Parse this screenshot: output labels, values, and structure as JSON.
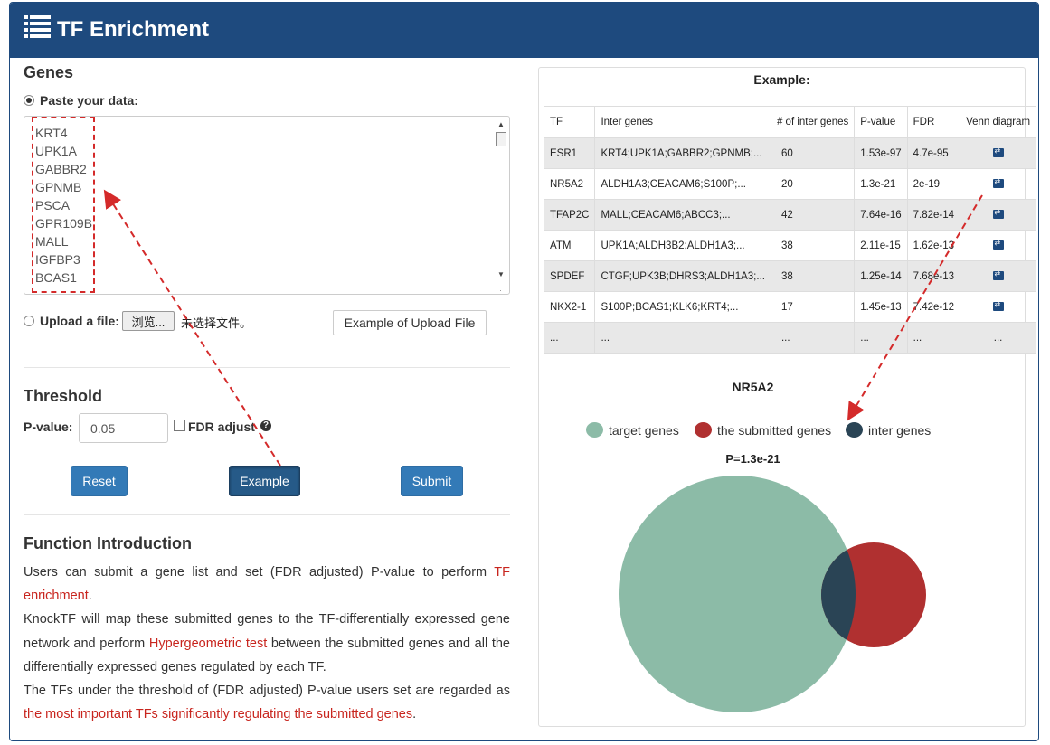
{
  "header": {
    "title": "TF Enrichment",
    "icon": "list-icon",
    "bg_color": "#1e4a7e"
  },
  "genes": {
    "section_title": "Genes",
    "paste_label": "Paste your data:",
    "gene_list": [
      "KRT4",
      "UPK1A",
      "GABBR2",
      "GPNMB",
      "PSCA",
      "GPR109B",
      "MALL",
      "IGFBP3",
      "BCAS1"
    ],
    "upload_label": "Upload a file:",
    "browse_button": "浏览...",
    "no_file_text": "未选择文件。",
    "example_upload_button": "Example of Upload File"
  },
  "threshold": {
    "section_title": "Threshold",
    "pvalue_label": "P-value:",
    "pvalue_value": "0.05",
    "fdr_label": "FDR adjust",
    "fdr_checked": false,
    "help_icon": "question-circle-icon",
    "reset_button": "Reset",
    "example_button": "Example",
    "submit_button": "Submit"
  },
  "intro": {
    "section_title": "Function Introduction",
    "p1_a": "Users can submit a gene list and set (FDR adjusted) P-value to perform ",
    "p1_red": "TF enrichment",
    "p1_b": ".",
    "p2_a": "KnockTF will map these submitted genes to the TF-differentially expressed gene network and perform ",
    "p2_red": "Hypergeometric test",
    "p2_b": " between the submitted genes and all the differentially expressed genes regulated by each TF.",
    "p3_a": "The TFs under the threshold of (FDR adjusted) P-value users set are regarded as ",
    "p3_red": "the most important TFs significantly regulating the submitted genes",
    "p3_b": "."
  },
  "example_panel": {
    "title": "Example:",
    "columns": [
      "TF",
      "Inter genes",
      "# of inter genes",
      "P-value",
      "FDR",
      "Venn diagram"
    ],
    "rows": [
      {
        "tf": "ESR1",
        "genes": "KRT4;UPK1A;GABBR2;GPNMB;...",
        "count": "60",
        "pvalue": "1.53e-97",
        "fdr": "4.7e-95"
      },
      {
        "tf": "NR5A2",
        "genes": "ALDH1A3;CEACAM6;S100P;...",
        "count": "20",
        "pvalue": "1.3e-21",
        "fdr": "2e-19"
      },
      {
        "tf": "TFAP2C",
        "genes": "MALL;CEACAM6;ABCC3;...",
        "count": "42",
        "pvalue": "7.64e-16",
        "fdr": "7.82e-14"
      },
      {
        "tf": "ATM",
        "genes": "UPK1A;ALDH3B2;ALDH1A3;...",
        "count": "38",
        "pvalue": "2.11e-15",
        "fdr": "1.62e-13"
      },
      {
        "tf": "SPDEF",
        "genes": "CTGF;UPK3B;DHRS3;ALDH1A3;...",
        "count": "38",
        "pvalue": "1.25e-14",
        "fdr": "7.68e-13"
      },
      {
        "tf": "NKX2-1",
        "genes": "S100P;BCAS1;KLK6;KRT4;...",
        "count": "17",
        "pvalue": "1.45e-13",
        "fdr": "7.42e-12"
      },
      {
        "tf": "...",
        "genes": "...",
        "count": "...",
        "pvalue": "...",
        "fdr": "..."
      }
    ],
    "venn_icon": "venn-diagram-icon"
  },
  "venn": {
    "title": "NR5A2",
    "legend": [
      {
        "label": "target genes",
        "color": "#8cbba7"
      },
      {
        "label": "the submitted genes",
        "color": "#b03030"
      },
      {
        "label": "inter genes",
        "color": "#2a4455"
      }
    ],
    "pvalue_text": "P=1.3e-21"
  },
  "colors": {
    "accent": "#337ab7",
    "annotation": "#d42a2a",
    "link_red": "#c8251e"
  }
}
